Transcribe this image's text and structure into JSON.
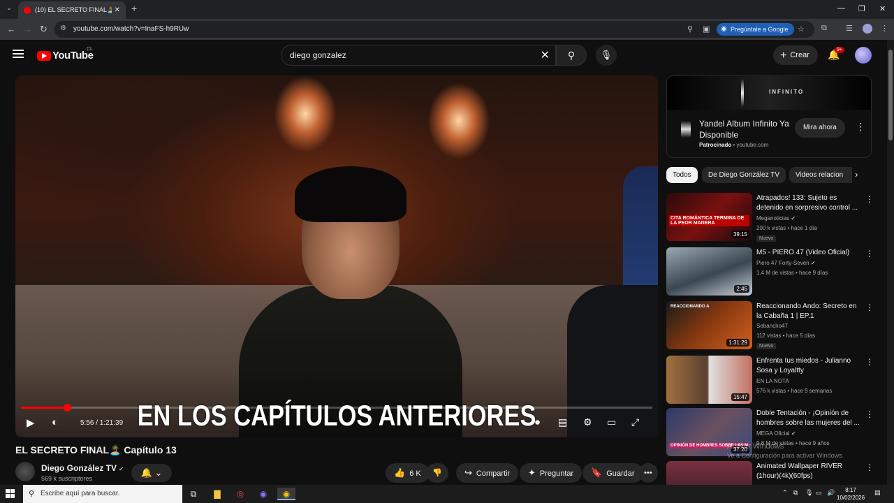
{
  "browser": {
    "tab_title": "(10) EL SECRETO FINAL🏝️ Capí",
    "url": "youtube.com/watch?v=InaFS-h9RUw",
    "ask_google": "Pregúntale a Google",
    "window_controls": [
      "—",
      "❐",
      "✕"
    ]
  },
  "header": {
    "logo_text": "YouTube",
    "country": "CL",
    "search_value": "diego gonzalez",
    "create_label": "Crear",
    "notif_badge": "9+"
  },
  "player": {
    "subtitle": "EN LOS CAPÍTULOS ANTERIORES",
    "time": "5:56 / 1:21:39",
    "progress": 0.073
  },
  "video": {
    "title": "EL SECRETO FINAL🏝️ Capítulo 13",
    "channel": "Diego González TV",
    "subscribers": "569 k suscriptores",
    "likes": "6 K",
    "share_label": "Compartir",
    "ask_label": "Preguntar",
    "save_label": "Guardar"
  },
  "ad": {
    "brand": "INFINITO",
    "title": "Yandel Album Infinito Ya Disponible",
    "sponsored": "Patrocinado",
    "domain": "youtube.com",
    "cta": "Mira ahora"
  },
  "chips": [
    "Todos",
    "De Diego González TV",
    "Videos relacion"
  ],
  "recommendations": [
    {
      "title": "Atrapados! 133: Sujeto es detenido en sorpresivo control ...",
      "channel": "Meganoticias",
      "meta": "200 k vistas • hace 1 día",
      "badge": "Nuevo",
      "duration": "39:15",
      "thumb_text": "CITA ROMÁNTICA TERMINA DE LA PEOR MANERA",
      "color": "#7a1010"
    },
    {
      "title": "M5 - PIERO 47 (Video Oficial)",
      "channel": "Piero 47 Forty-Seven",
      "meta": "1.4 M de vistas • hace 9 días",
      "badge": "",
      "duration": "2:45",
      "thumb_text": "",
      "color": "#5a6a78"
    },
    {
      "title": "Reaccionando Ando: Secreto en la Cabaña 1 | EP.1",
      "channel": "Sebancho47",
      "meta": "112 vistas • hace 5 días",
      "badge": "Nuevo",
      "duration": "1:31:29",
      "thumb_text": "REACCIONANDO A",
      "color": "#8a3a10"
    },
    {
      "title": "Enfrenta tus miedos - Julianno Sosa y Loyaltty",
      "channel": "EN LA NOTA",
      "meta": "576 k vistas • hace 9 semanas",
      "badge": "",
      "duration": "15:47",
      "thumb_text": "",
      "color": "#9a6a40"
    },
    {
      "title": "Doble Tentación - ¡Opinión de hombres sobre las mujeres del ...",
      "channel": "MEGA Oficial",
      "meta": "9.8 M de vistas • hace 9 años",
      "badge": "",
      "duration": "37:20",
      "thumb_text": "OPINIÓN DE HOMBRES SOBRE LAS M",
      "color": "#3a4a7a"
    },
    {
      "title": "Animated Wallpaper RIVER (1hour)(4k)(60fps)",
      "channel": "",
      "meta": "",
      "badge": "",
      "duration": "",
      "thumb_text": "",
      "color": "#5a2a30"
    }
  ],
  "watermark": {
    "line1": "Activar Windows",
    "line2": "Ve a Configuración para activar Windows."
  },
  "taskbar": {
    "search_placeholder": "Escribe aquí para buscar.",
    "time": "8:17",
    "date": "10/02/2026"
  }
}
